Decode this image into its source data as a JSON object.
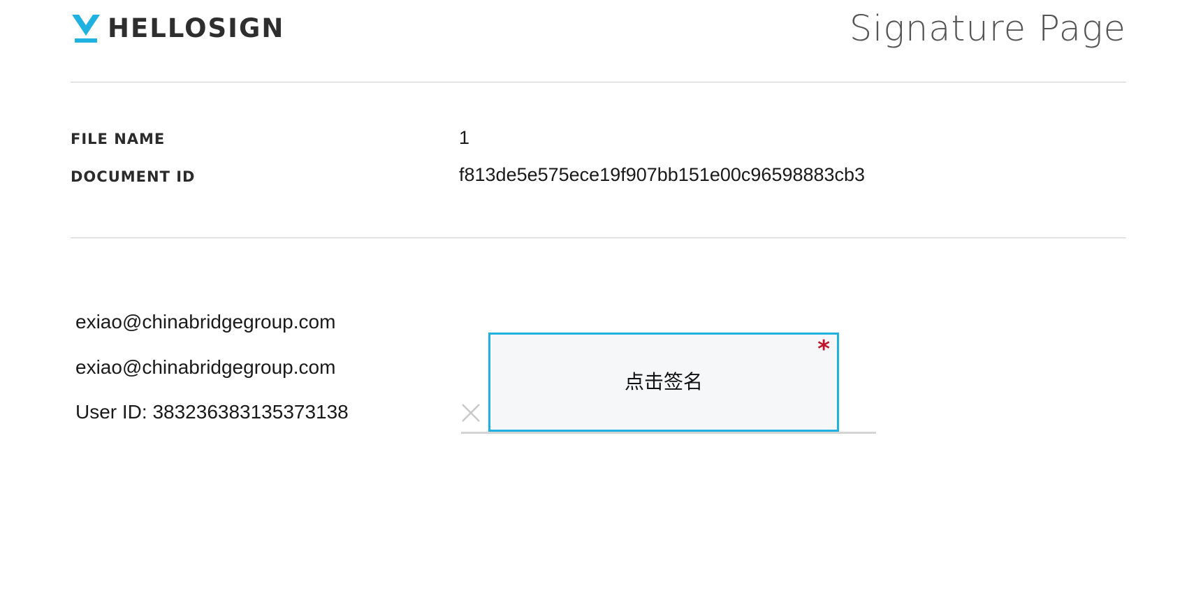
{
  "header": {
    "logo_text": "HELLOSIGN",
    "page_title": "Signature Page"
  },
  "document": {
    "file_name_label": "FILE NAME",
    "file_name_value": "1",
    "document_id_label": "DOCUMENT ID",
    "document_id_value": "f813de5e575ece19f907bb151e00c96598883cb3"
  },
  "signer": {
    "email_line_1": "exiao@chinabridgegroup.com",
    "email_line_2": "exiao@chinabridgegroup.com",
    "user_id": "User ID: 383236383135373138"
  },
  "signature_field": {
    "label": "点击签名",
    "required_marker": "*"
  },
  "icons": {
    "logo": "hellosign-logo-icon",
    "sign_x": "close-icon"
  },
  "colors": {
    "brand": "#1fb1e0",
    "required": "#c0142a",
    "divider": "#cfcfcf",
    "field_background": "#f5f7f9"
  }
}
